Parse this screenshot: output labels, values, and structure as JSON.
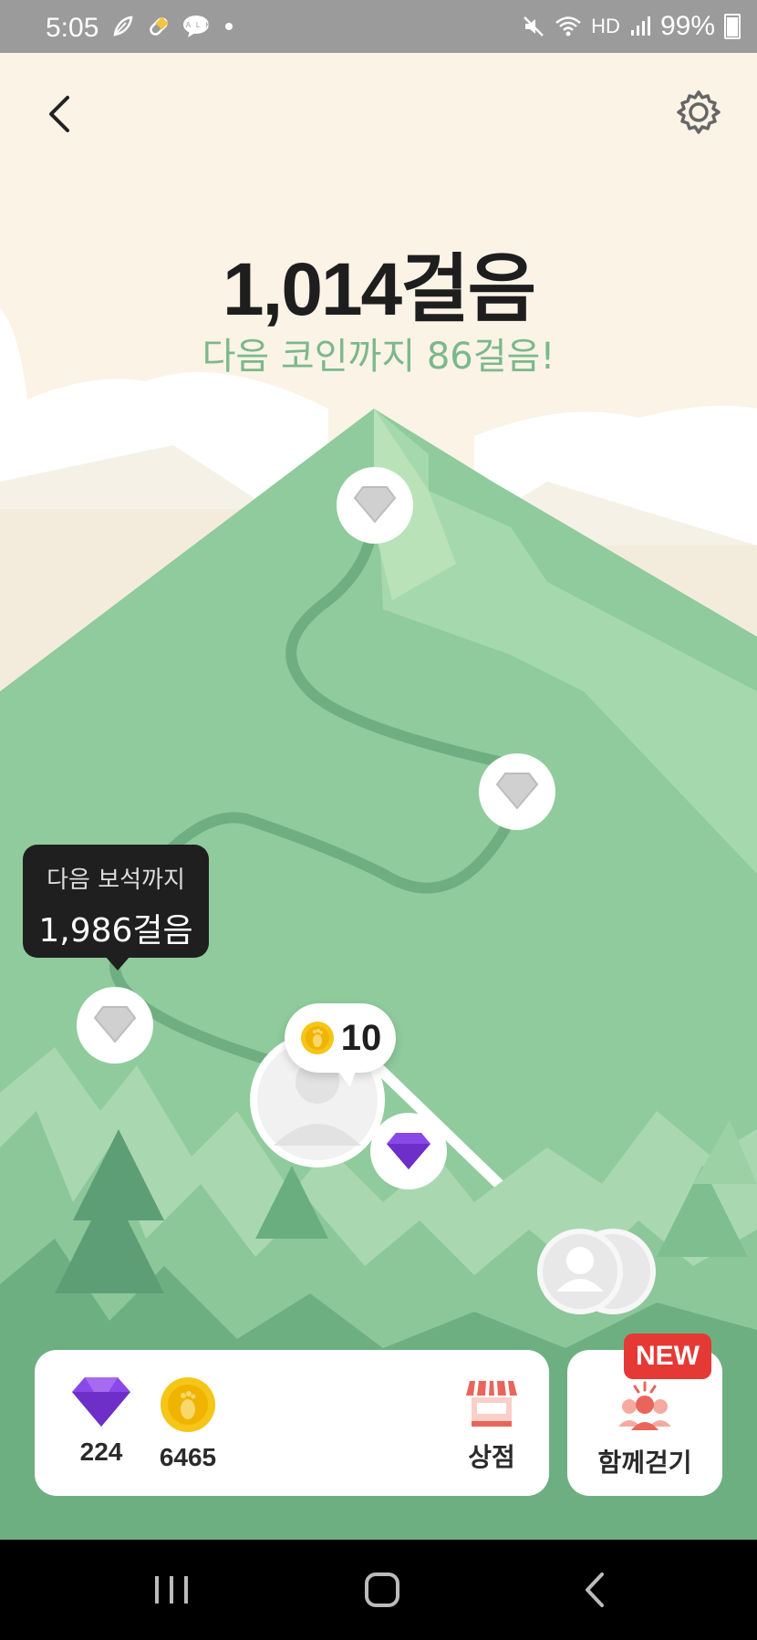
{
  "status_bar": {
    "time": "5:05",
    "notification_icons": [
      "leaf-icon",
      "pill-icon",
      "talk-icon",
      "dot-icon"
    ],
    "talk_label": "TALK",
    "hd_label": "HD",
    "battery": "99%"
  },
  "header": {
    "steps": "1,014걸음",
    "next_coin_text": "다음 코인까지 86걸음!"
  },
  "tooltip": {
    "line1": "다음 보석까지",
    "line2": "1,986걸음"
  },
  "coin_bubble": {
    "value": "10"
  },
  "bottom": {
    "gems": "224",
    "coins": "6465",
    "shop_label": "상점",
    "together_label": "함께걷기",
    "new_badge": "NEW"
  },
  "colors": {
    "sky": "#FAF3E6",
    "mountain": "#8FCB9C",
    "forest_dark": "#5E9E77",
    "accent_text": "#7CB88C",
    "gem_purple": "#8B48E8",
    "coin_gold": "#F5C518",
    "new_badge": "#E53935"
  }
}
